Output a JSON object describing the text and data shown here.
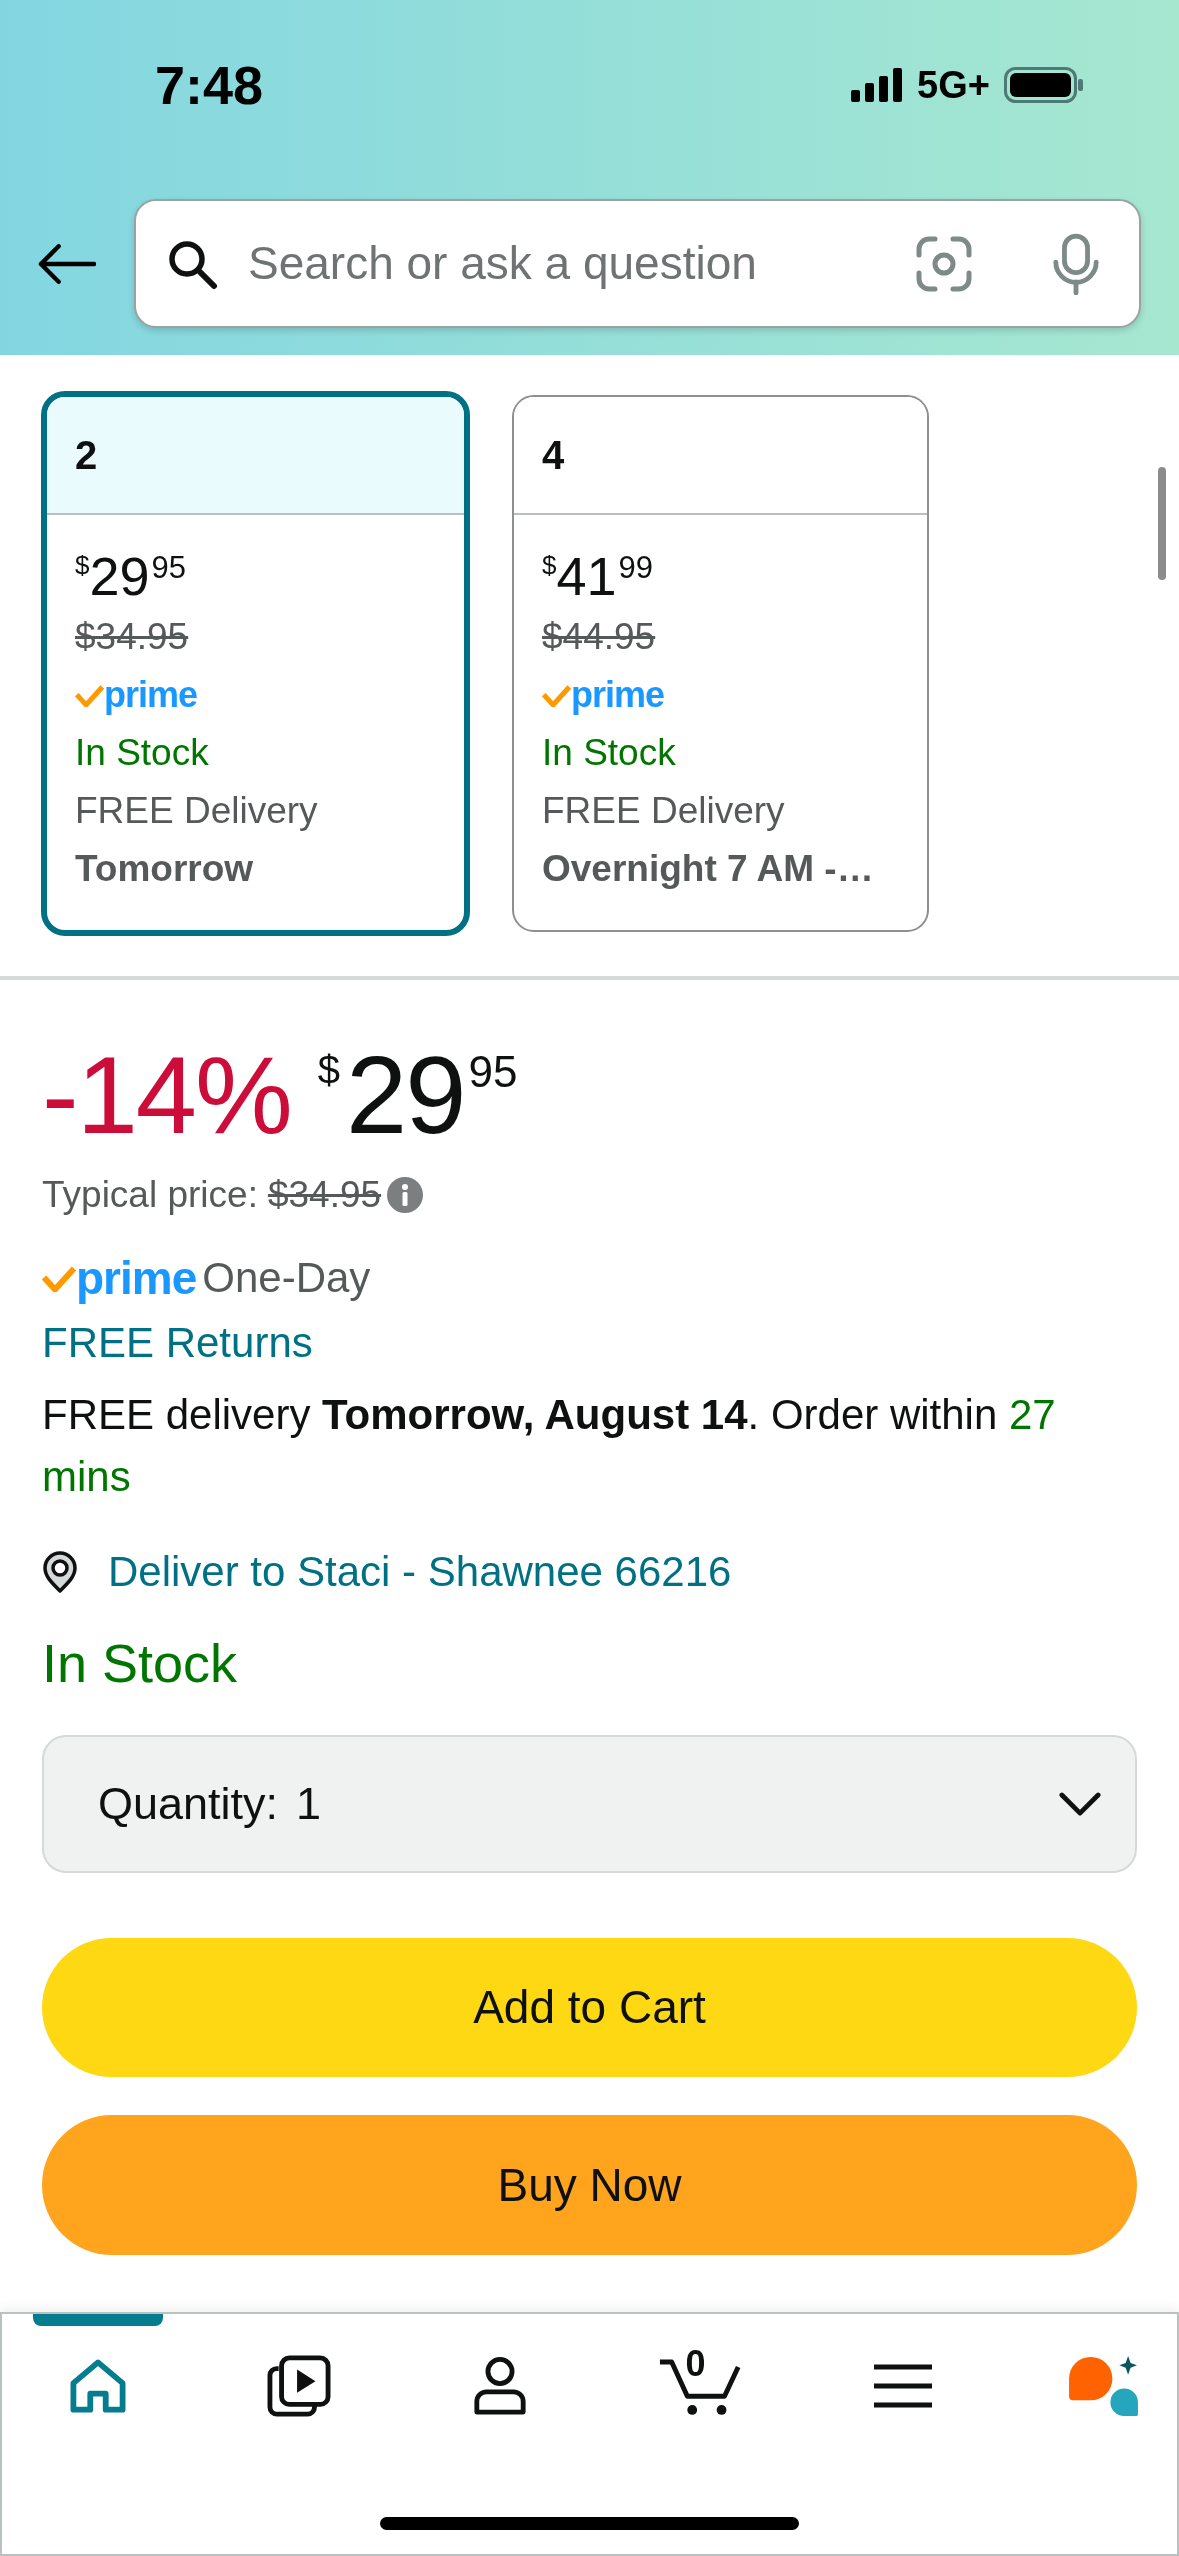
{
  "status_bar": {
    "time": "7:48",
    "network": "5G+"
  },
  "search": {
    "placeholder": "Search or ask a question"
  },
  "options": [
    {
      "label": "2",
      "selected": true,
      "price": {
        "currency": "$",
        "whole": "29",
        "fraction": "95"
      },
      "list_price": "$34.95",
      "prime": "prime",
      "stock": "In Stock",
      "delivery": "FREE Delivery",
      "delivery_date": "Tomorrow"
    },
    {
      "label": "4",
      "selected": false,
      "price": {
        "currency": "$",
        "whole": "41",
        "fraction": "99"
      },
      "list_price": "$44.95",
      "prime": "prime",
      "stock": "In Stock",
      "delivery": "FREE Delivery",
      "delivery_date": "Overnight 7 AM -…"
    }
  ],
  "buybox": {
    "discount": "-14%",
    "price": {
      "currency": "$",
      "whole": "29",
      "fraction": "95"
    },
    "typical_price_label": "Typical price:",
    "typical_price": "$34.95",
    "prime": "prime",
    "prime_tier": "One-Day",
    "returns": "FREE Returns",
    "delivery_message": "FREE delivery **Tomorrow, August 14**. Order within",
    "delivery_countdown": "27 mins",
    "deliver_to": "Deliver to Staci - Shawnee 66216",
    "stock": "In Stock",
    "quantity": {
      "label": "Quantity:",
      "value": "1"
    },
    "buttons": [
      {
        "kind": "add_to_cart",
        "label": "Add to Cart"
      },
      {
        "kind": "buy_now",
        "label": "Buy Now"
      }
    ]
  },
  "bottom_nav": {
    "items": [
      {
        "kind": "home",
        "selected": true
      },
      {
        "kind": "video",
        "selected": false
      },
      {
        "kind": "account",
        "selected": false
      },
      {
        "kind": "cart",
        "selected": false,
        "badge": "0"
      },
      {
        "kind": "menu",
        "selected": false
      },
      {
        "kind": "assistant",
        "selected": false
      }
    ]
  }
}
